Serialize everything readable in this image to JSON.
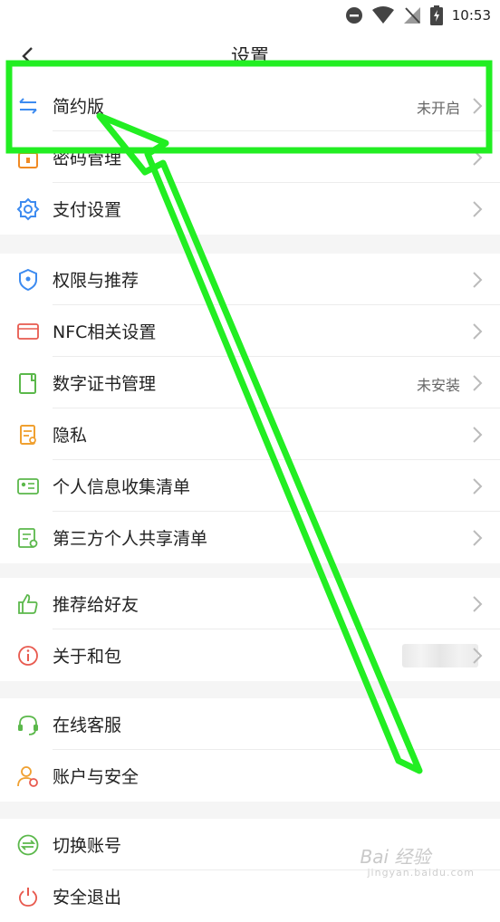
{
  "status_bar": {
    "time": "10:53",
    "icons": [
      "minus-circle-icon",
      "wifi-icon",
      "no-signal-icon",
      "battery-charging-icon"
    ]
  },
  "header": {
    "title": "设置",
    "back_icon": "chevron-left-icon"
  },
  "groups": [
    {
      "items": [
        {
          "label": "简约版",
          "value": "未开启",
          "icon": "swap-arrows-icon",
          "color": "#3d8bf0"
        },
        {
          "label": "密码管理",
          "value": "",
          "icon": "lock-icon",
          "color": "#f08a24"
        },
        {
          "label": "支付设置",
          "value": "",
          "icon": "gear-icon",
          "color": "#3d8bf0"
        }
      ]
    },
    {
      "items": [
        {
          "label": "权限与推荐",
          "value": "",
          "icon": "shield-icon",
          "color": "#3d8bf0"
        },
        {
          "label": "NFC相关设置",
          "value": "",
          "icon": "nfc-card-icon",
          "color": "#e85a4f"
        },
        {
          "label": "数字证书管理",
          "value": "未安装",
          "icon": "certificate-icon",
          "color": "#5bb84b"
        },
        {
          "label": "隐私",
          "value": "",
          "icon": "privacy-doc-icon",
          "color": "#f0a030"
        },
        {
          "label": "个人信息收集清单",
          "value": "",
          "icon": "id-card-icon",
          "color": "#5bb84b"
        },
        {
          "label": "第三方个人共享清单",
          "value": "",
          "icon": "share-list-icon",
          "color": "#5bb84b"
        }
      ]
    },
    {
      "items": [
        {
          "label": "推荐给好友",
          "value": "",
          "icon": "thumbs-up-icon",
          "color": "#5bb84b"
        },
        {
          "label": "关于和包",
          "value": "",
          "icon": "info-icon",
          "color": "#e85a4f"
        }
      ]
    },
    {
      "items": [
        {
          "label": "在线客服",
          "value": "",
          "icon": "headset-icon",
          "color": "#5bb84b"
        },
        {
          "label": "账户与安全",
          "value": "",
          "icon": "user-shield-icon",
          "color": "#f0a030"
        }
      ]
    },
    {
      "items": [
        {
          "label": "切换账号",
          "value": "",
          "icon": "switch-account-icon",
          "color": "#5bb84b"
        },
        {
          "label": "安全退出",
          "value": "",
          "icon": "power-icon",
          "color": "#e85a4f"
        }
      ]
    }
  ],
  "annotation": {
    "color": "#22ee22"
  },
  "watermark": {
    "text": "Bai 经验",
    "sub": "jingyan.baidu.com"
  }
}
